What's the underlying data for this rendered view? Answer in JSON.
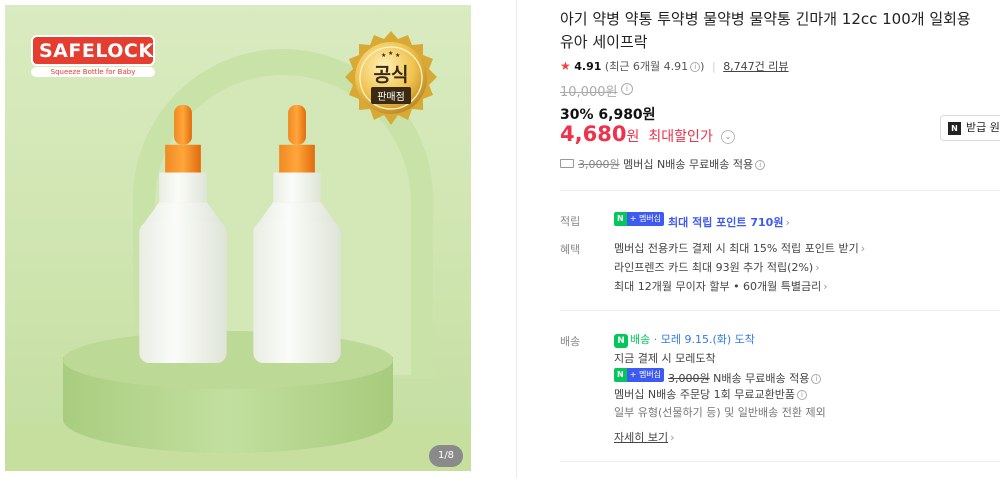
{
  "gallery": {
    "brand_logo": "SAFELOCK",
    "brand_tagline": "Squeeze Bottle for Baby",
    "seal_line1": "공식",
    "seal_line2": "판매점",
    "counter": "1/8"
  },
  "product": {
    "title_line1": "아기 약병 약통 투약병 물약병 물약통 긴마개 12cc 100개 일회용",
    "title_line2": "유아 세이프락",
    "rating_score": "4.91",
    "rating_recent": "(최근 6개월 4.91",
    "reviews": "8,747건 리뷰",
    "original_price": "10,000원",
    "discount_percent": "30%",
    "discount_price": "6,980원",
    "max_price_num": "4,680",
    "max_price_won": "원",
    "max_price_label": "최대할인가",
    "coupon_button": "받급 원",
    "shipping_fee": "3,000원",
    "shipping_note": "멤버십 N배송 무료배송 적용"
  },
  "benefits": {
    "points_label": "적립",
    "points_badge_n": "N",
    "points_badge_membership": "+ 멤버십",
    "points_text": "최대 적립 포인트 710원",
    "perks_label": "혜택",
    "perk1": "멤버십 전용카드 결제 시 최대 15% 적립 포인트 받기",
    "perk2": "라인프렌즈 카드 최대 93원 추가 적립(2%)",
    "perk3": "최대 12개월 무이자 할부 • 60개월 특별금리"
  },
  "delivery": {
    "label": "배송",
    "n_delivery": "배송",
    "arrival": "모레 9.15.(화) 도착",
    "pay_now": "지금 결제 시 모레도착",
    "badge_n": "N",
    "badge_membership": "+ 멤버십",
    "fee_struck": "3,000원",
    "fee_note": "N배송 무료배송 적용",
    "exchange": "멤버십 N배송 주문당 1회 무료교환반품",
    "partial": "일부 유형(선물하기 등) 및 일반배송 전환 제외",
    "more_link": "자세히 보기"
  },
  "colors": {
    "price_red": "#f0314a",
    "naver_green": "#03c75a",
    "membership_blue": "#3d5af1",
    "background_green": "#cfe5b0",
    "cap_orange": "#f07a14"
  }
}
